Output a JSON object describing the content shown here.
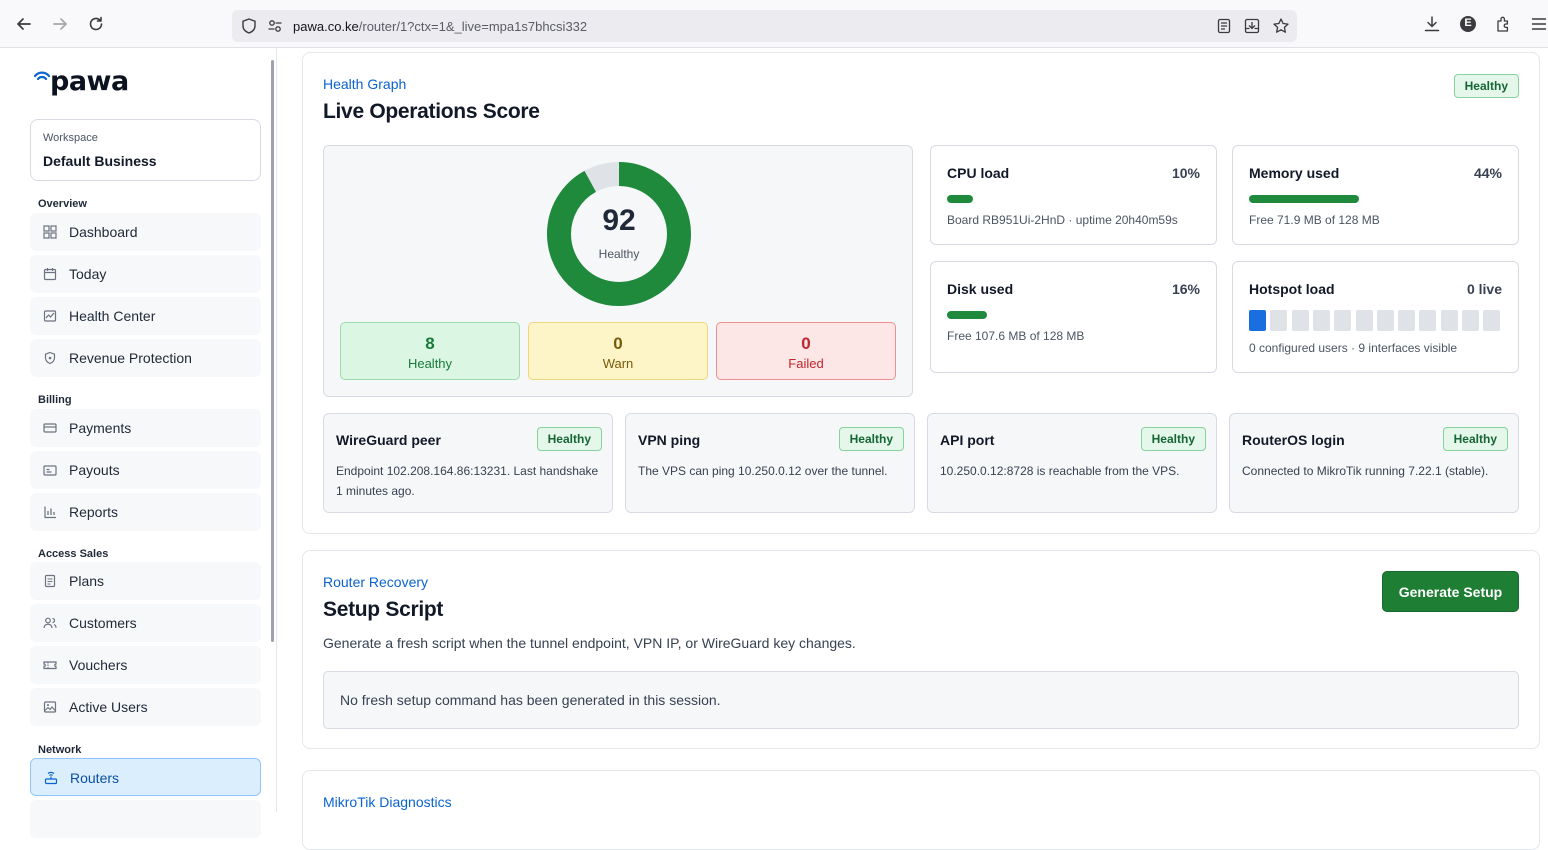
{
  "browser": {
    "url_host": "pawa.co.ke",
    "url_path": "/router/1?ctx=1&_live=mpa1s7bhcsi332",
    "profile_initial": "E"
  },
  "sidebar": {
    "logo": "pawa",
    "workspace_label": "Workspace",
    "workspace_name": "Default Business",
    "sections": [
      {
        "title": "Overview",
        "items": [
          {
            "label": "Dashboard",
            "icon": "grid-icon"
          },
          {
            "label": "Today",
            "icon": "calendar-icon"
          },
          {
            "label": "Health Center",
            "icon": "pulse-chart-icon"
          },
          {
            "label": "Revenue Protection",
            "icon": "shield-icon"
          }
        ]
      },
      {
        "title": "Billing",
        "items": [
          {
            "label": "Payments",
            "icon": "credit-card-icon"
          },
          {
            "label": "Payouts",
            "icon": "wallet-icon"
          },
          {
            "label": "Reports",
            "icon": "bar-chart-icon"
          }
        ]
      },
      {
        "title": "Access Sales",
        "items": [
          {
            "label": "Plans",
            "icon": "document-icon"
          },
          {
            "label": "Customers",
            "icon": "users-icon"
          },
          {
            "label": "Vouchers",
            "icon": "ticket-icon"
          },
          {
            "label": "Active Users",
            "icon": "image-icon"
          }
        ]
      },
      {
        "title": "Network",
        "items": [
          {
            "label": "Routers",
            "icon": "router-icon",
            "active": true
          }
        ]
      }
    ]
  },
  "health": {
    "eyebrow": "Health Graph",
    "title": "Live Operations Score",
    "status_badge": "Healthy",
    "score": 92,
    "score_label": "Healthy",
    "counts": [
      {
        "value": "8",
        "label": "Healthy"
      },
      {
        "value": "0",
        "label": "Warn"
      },
      {
        "value": "0",
        "label": "Failed"
      }
    ],
    "stats": {
      "cpu": {
        "title": "CPU load",
        "value": "10%",
        "percent": 10,
        "sub": "Board RB951Ui-2HnD · uptime 20h40m59s"
      },
      "memory": {
        "title": "Memory used",
        "value": "44%",
        "percent": 44,
        "sub": "Free 71.9 MB of 128 MB"
      },
      "disk": {
        "title": "Disk used",
        "value": "16%",
        "percent": 16,
        "sub": "Free 107.6 MB of 128 MB"
      },
      "hotspot": {
        "title": "Hotspot load",
        "value": "0 live",
        "sub": "0 configured users · 9 interfaces visible",
        "cells": 12,
        "active_cells": 1
      }
    },
    "checks": [
      {
        "title": "WireGuard peer",
        "status": "Healthy",
        "desc": "Endpoint 102.208.164.86:13231. Last handshake 1 minutes ago."
      },
      {
        "title": "VPN ping",
        "status": "Healthy",
        "desc": "The VPS can ping 10.250.0.12 over the tunnel."
      },
      {
        "title": "API port",
        "status": "Healthy",
        "desc": "10.250.0.12:8728 is reachable from the VPS."
      },
      {
        "title": "RouterOS login",
        "status": "Healthy",
        "desc": "Connected to MikroTik running 7.22.1 (stable)."
      }
    ]
  },
  "recovery": {
    "eyebrow": "Router Recovery",
    "title": "Setup Script",
    "button": "Generate Setup",
    "description": "Generate a fresh script when the tunnel endpoint, VPN IP, or WireGuard key changes.",
    "empty_message": "No fresh setup command has been generated in this session."
  },
  "diagnostics": {
    "eyebrow": "MikroTik Diagnostics"
  },
  "colors": {
    "accent": "#0b63ce",
    "healthy": "#1f8a3b",
    "button": "#1e7e34"
  }
}
